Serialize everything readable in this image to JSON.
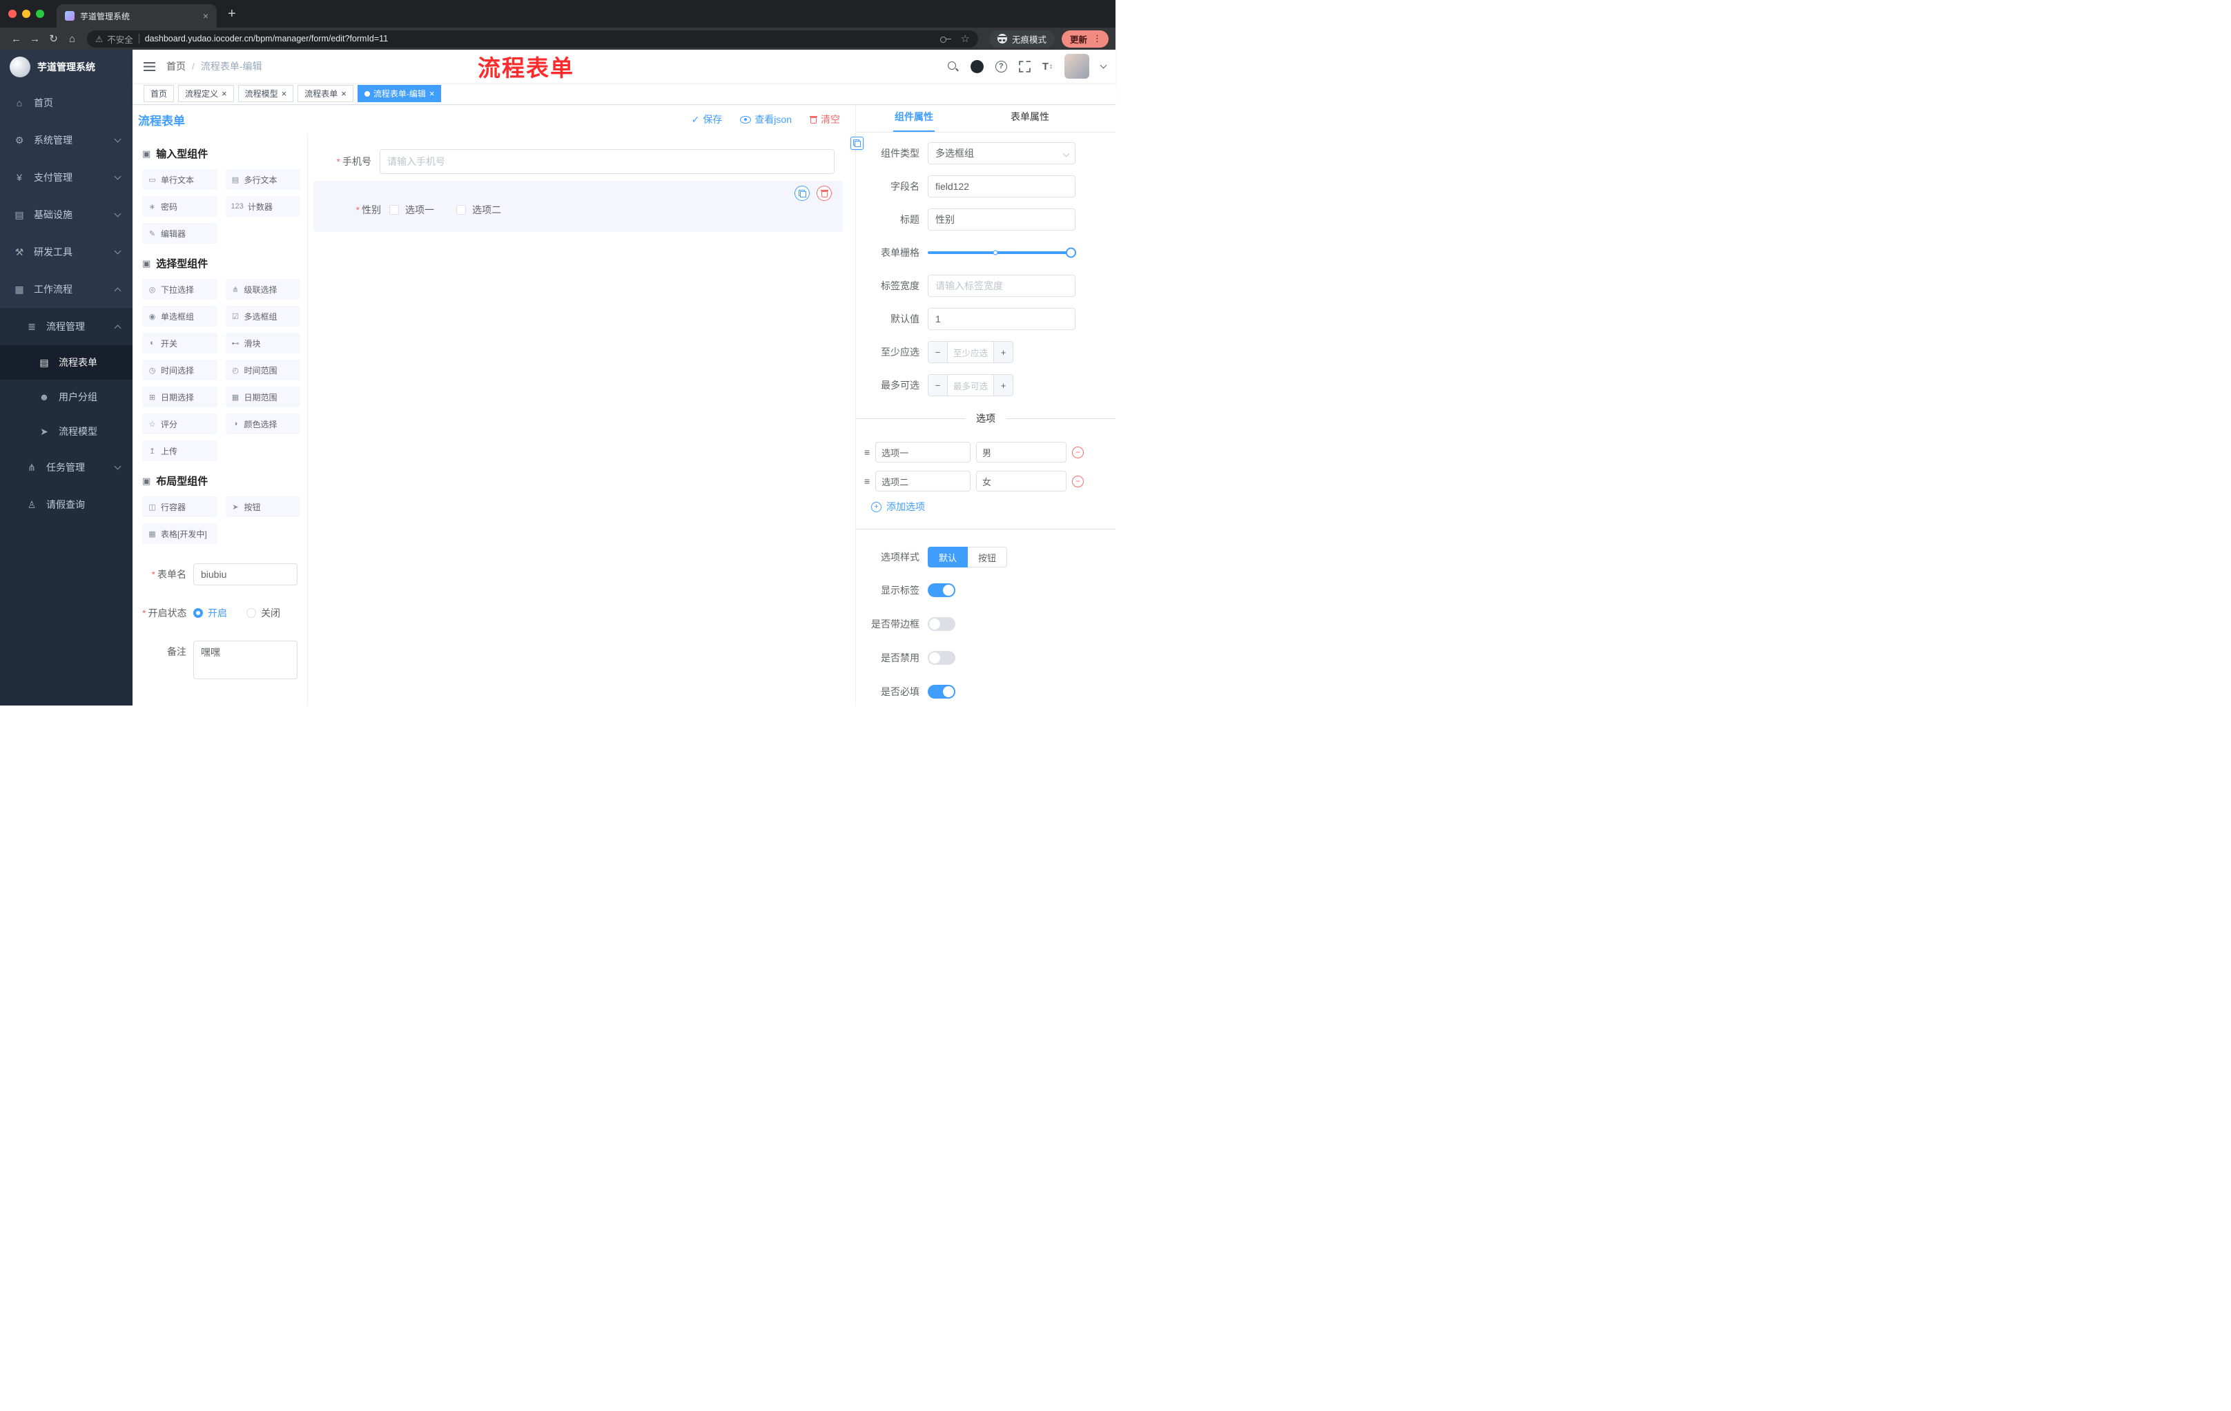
{
  "browser": {
    "tab_title": "芋道管理系统",
    "new_tab": "+",
    "close_tab": "×",
    "back": "←",
    "forward": "→",
    "reload": "↻",
    "home": "⌂",
    "warning": "⚠",
    "security_label": "不安全",
    "url": "dashboard.yudao.iocoder.cn/bpm/manager/form/edit?formId=11",
    "star": "☆",
    "incognito_label": "无痕模式",
    "update_label": "更新",
    "kebab": "⋮"
  },
  "sidebar": {
    "logo_title": "芋道管理系统",
    "items": [
      {
        "icon": "⌂",
        "label": "首页"
      },
      {
        "icon": "⚙",
        "label": "系统管理"
      },
      {
        "icon": "¥",
        "label": "支付管理"
      },
      {
        "icon": "▤",
        "label": "基础设施"
      },
      {
        "icon": "⚒",
        "label": "研发工具"
      },
      {
        "icon": "▦",
        "label": "工作流程"
      },
      {
        "icon": "≣",
        "label": "流程管理"
      },
      {
        "icon": "▤",
        "label": "流程表单"
      },
      {
        "icon": "☻",
        "label": "用户分组"
      },
      {
        "icon": "➤",
        "label": "流程模型"
      },
      {
        "icon": "⋔",
        "label": "任务管理"
      },
      {
        "icon": "♙",
        "label": "请假查询"
      }
    ]
  },
  "navbar": {
    "breadcrumb_home": "首页",
    "breadcrumb_sep": "/",
    "breadcrumb_current": "流程表单-编辑",
    "annotation": "流程表单",
    "size_icon_text": "T"
  },
  "tags": [
    {
      "label": "首页"
    },
    {
      "label": "流程定义"
    },
    {
      "label": "流程模型"
    },
    {
      "label": "流程表单"
    },
    {
      "label": "流程表单-编辑"
    }
  ],
  "ui": {
    "close": "×",
    "minus": "−",
    "plus": "+",
    "check": "✓",
    "drag": "≡"
  },
  "designer": {
    "title": "流程表单",
    "save": "保存",
    "view_json": "查看json",
    "clear": "清空",
    "groups": [
      {
        "icon": "▣",
        "title": "输入型组件",
        "items": [
          {
            "icon": "▭",
            "label": "单行文本"
          },
          {
            "icon": "▤",
            "label": "多行文本"
          },
          {
            "icon": "∗",
            "label": "密码"
          },
          {
            "icon": "123",
            "label": "计数器"
          },
          {
            "icon": "✎",
            "label": "编辑器"
          }
        ]
      },
      {
        "icon": "▣",
        "title": "选择型组件",
        "items": [
          {
            "icon": "◎",
            "label": "下拉选择"
          },
          {
            "icon": "⋔",
            "label": "级联选择"
          },
          {
            "icon": "◉",
            "label": "单选框组"
          },
          {
            "icon": "☑",
            "label": "多选框组"
          },
          {
            "icon": "◐",
            "label": "开关"
          },
          {
            "icon": "⊷",
            "label": "滑块"
          },
          {
            "icon": "◷",
            "label": "时间选择"
          },
          {
            "icon": "◴",
            "label": "时间范围"
          },
          {
            "icon": "⊞",
            "label": "日期选择"
          },
          {
            "icon": "▦",
            "label": "日期范围"
          },
          {
            "icon": "☆",
            "label": "评分"
          },
          {
            "icon": "◑",
            "label": "颜色选择"
          },
          {
            "icon": "↥",
            "label": "上传"
          }
        ]
      },
      {
        "icon": "▣",
        "title": "布局型组件",
        "items": [
          {
            "icon": "◫",
            "label": "行容器"
          },
          {
            "icon": "➤",
            "label": "按钮"
          },
          {
            "icon": "▦",
            "label": "表格[开发中]"
          }
        ]
      }
    ],
    "meta": {
      "name_label": "表单名",
      "name_value": "biubiu",
      "status_label": "开启状态",
      "status_on": "开启",
      "status_off": "关闭",
      "remark_label": "备注",
      "remark_value": "嘿嘿"
    },
    "canvas": {
      "phone_label": "手机号",
      "phone_placeholder": "请输入手机号",
      "gender_label": "性别",
      "gender_option1": "选项一",
      "gender_option2": "选项二"
    }
  },
  "panel": {
    "tab_component": "组件属性",
    "tab_form": "表单属性",
    "rows": {
      "type_label": "组件类型",
      "type_value": "多选框组",
      "field_label": "字段名",
      "field_value": "field122",
      "title_label": "标题",
      "title_value": "性别",
      "grid_label": "表单栅格",
      "width_label": "标签宽度",
      "width_placeholder": "请输入标签宽度",
      "default_label": "默认值",
      "default_value": "1",
      "min_label": "至少应选",
      "min_placeholder": "至少应选",
      "max_label": "最多可选",
      "max_placeholder": "最多可选"
    },
    "options": {
      "divider": "选项",
      "rows": [
        {
          "label": "选项一",
          "value": "男"
        },
        {
          "label": "选项二",
          "value": "女"
        }
      ],
      "add": "添加选项"
    },
    "style": {
      "label": "选项样式",
      "btn_default": "默认",
      "btn_button": "按钮",
      "toggle_show_label": "显示标签",
      "toggle_border": "是否带边框",
      "toggle_disabled": "是否禁用",
      "toggle_required": "是否必填"
    }
  },
  "colors": {
    "primary": "#409EFF",
    "danger": "#F56C6C",
    "annotation": "#FD2B2B"
  }
}
